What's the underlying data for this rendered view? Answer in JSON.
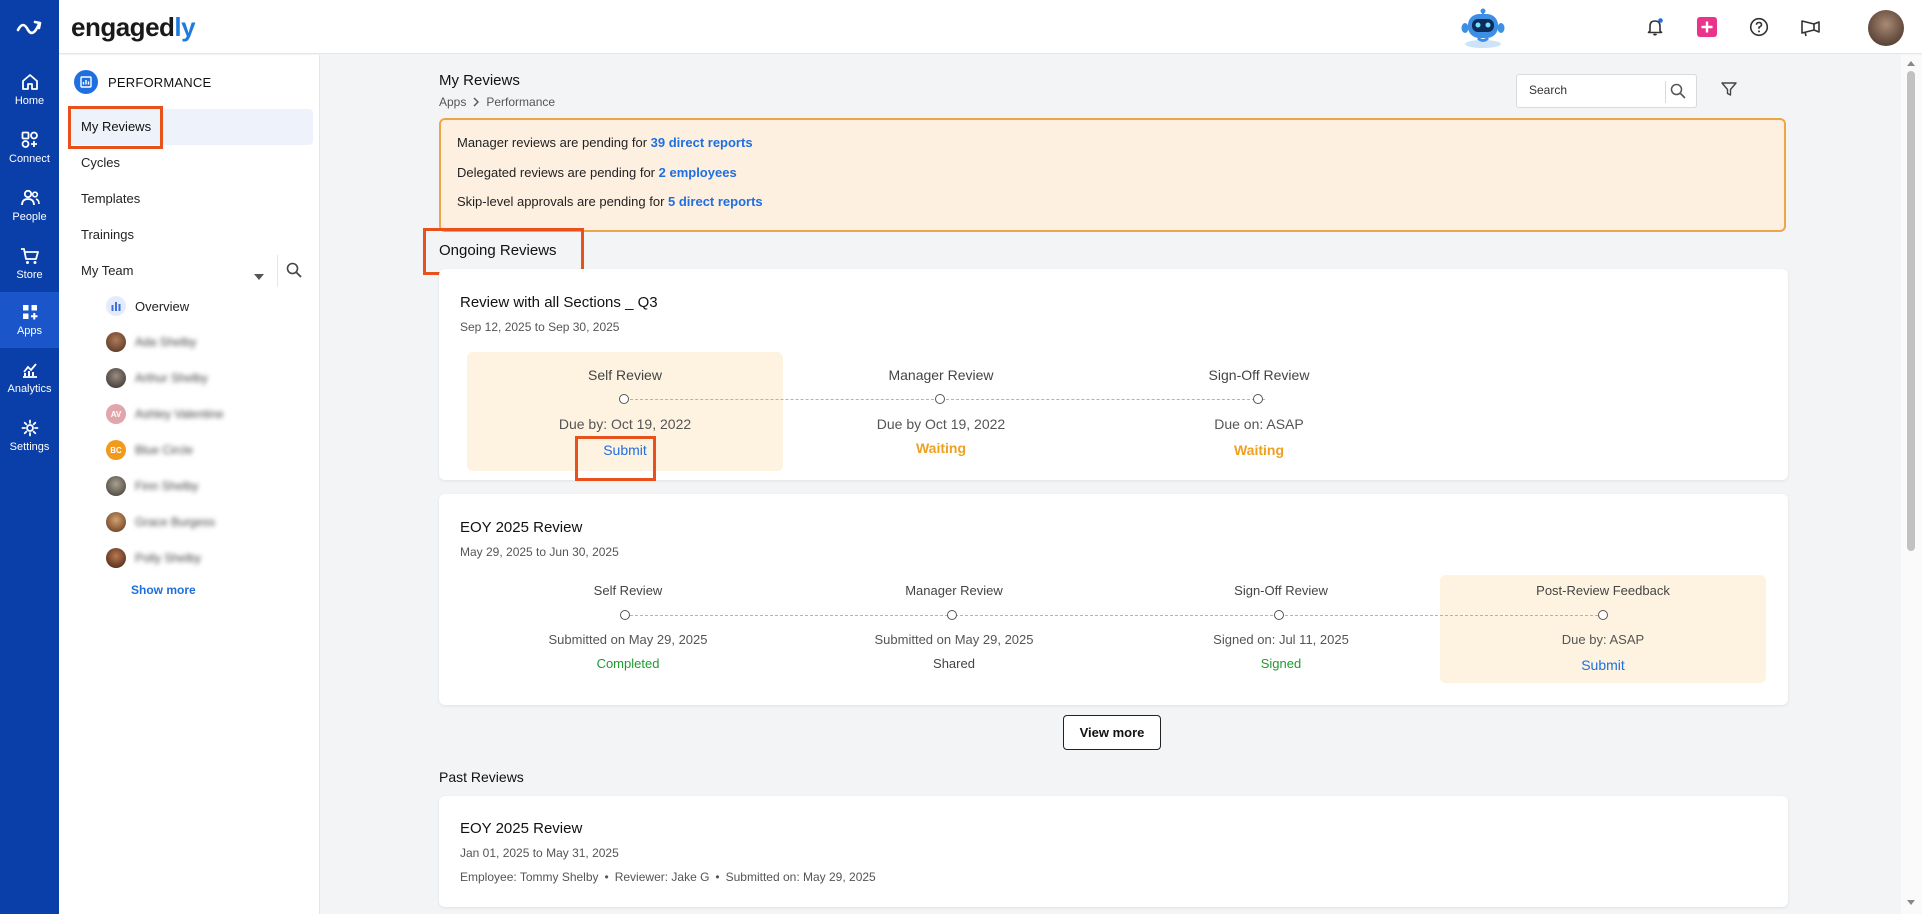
{
  "app": {
    "brand_main": "engaged",
    "brand_accent": "ly"
  },
  "rail": {
    "items": [
      {
        "label": "Home",
        "icon": "home-icon"
      },
      {
        "label": "Connect",
        "icon": "connect-icon"
      },
      {
        "label": "People",
        "icon": "people-icon"
      },
      {
        "label": "Store",
        "icon": "cart-icon"
      },
      {
        "label": "Apps",
        "icon": "apps-icon",
        "active": true
      },
      {
        "label": "Analytics",
        "icon": "analytics-icon"
      },
      {
        "label": "Settings",
        "icon": "gear-icon"
      }
    ]
  },
  "sidebar": {
    "section": "PERFORMANCE",
    "links": [
      "My Reviews",
      "Cycles",
      "Templates",
      "Trainings"
    ],
    "my_team": "My Team",
    "overview": "Overview",
    "members": [
      {
        "name": "Ada Shelby",
        "initials": ""
      },
      {
        "name": "Arthur Shelby",
        "initials": ""
      },
      {
        "name": "Ashley Valentine",
        "initials": "AV"
      },
      {
        "name": "Blue Circle",
        "initials": "BC"
      },
      {
        "name": "Finn Shelby",
        "initials": ""
      },
      {
        "name": "Grace Burgess",
        "initials": ""
      },
      {
        "name": "Polly Shelby",
        "initials": ""
      }
    ],
    "show_more": "Show more"
  },
  "main": {
    "title": "My Reviews",
    "breadcrumb": [
      "Apps",
      "Performance"
    ],
    "search_placeholder": "Search",
    "alerts": [
      {
        "text": "Manager reviews are pending for ",
        "link": "39 direct reports"
      },
      {
        "text": "Delegated reviews are pending for ",
        "link": "2 employees"
      },
      {
        "text": "Skip-level approvals are pending for ",
        "link": "5 direct reports"
      }
    ],
    "ongoing_title": "Ongoing Reviews",
    "ongoing": [
      {
        "title": "Review with all Sections _ Q3",
        "dates": "Sep 12, 2025 to Sep 30, 2025",
        "stages": [
          {
            "name": "Self Review",
            "due": "Due by: Oct 19, 2022",
            "status": "Submit"
          },
          {
            "name": "Manager Review",
            "due": "Due by Oct 19, 2022",
            "status": "Waiting"
          },
          {
            "name": "Sign-Off Review",
            "due": "Due on: ASAP",
            "status": "Waiting"
          }
        ]
      },
      {
        "title": "EOY 2025 Review",
        "dates": "May 29, 2025 to Jun 30, 2025",
        "stages": [
          {
            "name": "Self Review",
            "due": "Submitted on May 29, 2025",
            "status": "Completed"
          },
          {
            "name": "Manager Review",
            "due": "Submitted on May 29, 2025",
            "status": "Shared"
          },
          {
            "name": "Sign-Off Review",
            "due": "Signed on: Jul 11, 2025",
            "status": "Signed"
          },
          {
            "name": "Post-Review Feedback",
            "due": "Due by: ASAP",
            "status": "Submit"
          }
        ]
      }
    ],
    "view_more": "View more",
    "past_title": "Past Reviews",
    "past": [
      {
        "title": "EOY 2025 Review",
        "dates": "Jan 01, 2025 to May 31, 2025",
        "employee": "Employee: Tommy Shelby",
        "reviewer": "Reviewer: Jake G",
        "submitted": "Submitted on: May 29, 2025",
        "separator": "•"
      }
    ]
  },
  "colors": {
    "rail": "#0a3ea8",
    "accent": "#1f6fe0",
    "highlight": "#e8501c",
    "waiting": "#f0a020",
    "success": "#1e9a2e"
  }
}
